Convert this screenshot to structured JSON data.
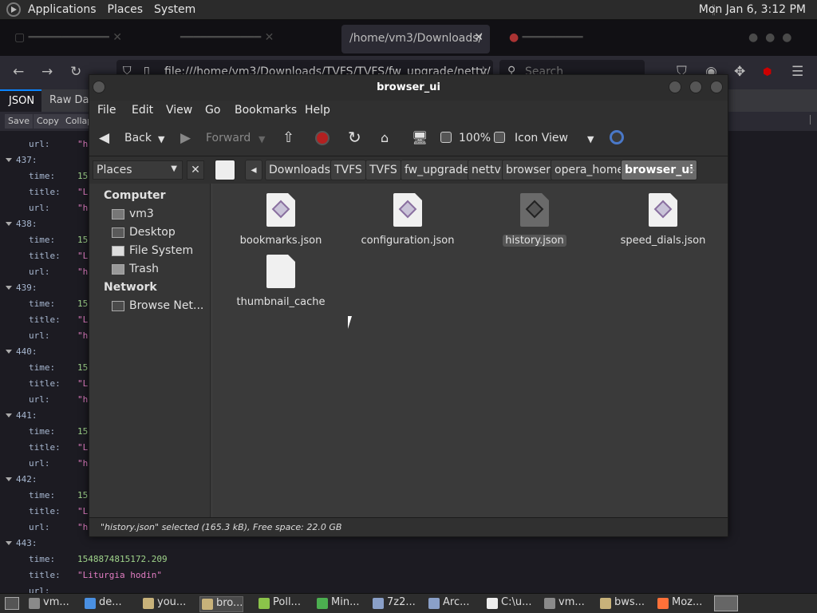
{
  "top_panel": {
    "menus": [
      "Applications",
      "Places",
      "System"
    ],
    "clock": "Mon Jan  6,  3:12 PM"
  },
  "browser": {
    "active_tab_title": "/home/vm3/Downloads/",
    "url": "file:///home/vm3/Downloads/TVFS/TVFS/fw_upgrade/nettv/",
    "search_placeholder": "Search",
    "json_tabs": [
      "JSON",
      "Raw Data"
    ],
    "json_tools": [
      "Save",
      "Copy",
      "Collap"
    ],
    "entries": [
      {
        "index": "437:",
        "time": "15",
        "title": "\"L",
        "url": "\"h"
      },
      {
        "index": "438:",
        "time": "15",
        "title": "\"L",
        "url": "\"h"
      },
      {
        "index": "439:",
        "time": "15",
        "title": "\"L",
        "url": "\"h"
      },
      {
        "index": "440:",
        "time": "15",
        "title": "\"L",
        "url": "\"h"
      },
      {
        "index": "441:",
        "time": "15",
        "title": "\"L",
        "url": "\"h"
      },
      {
        "index": "442:",
        "time": "15",
        "title": "\"L",
        "url": "\"h"
      },
      {
        "index": "443:",
        "time": "1548874815172.209",
        "title": "\"Liturgia hodin\"",
        "url": ""
      }
    ],
    "key_labels": {
      "time": "time:",
      "title": "title:",
      "url": "url:"
    },
    "first_url": "\"h"
  },
  "file_manager": {
    "title": "browser_ui",
    "menu": [
      "File",
      "Edit",
      "View",
      "Go",
      "Bookmarks",
      "Help"
    ],
    "toolbar": {
      "back": "Back",
      "forward": "Forward",
      "zoom": "100%",
      "view_mode": "Icon View"
    },
    "places_combo": "Places",
    "breadcrumbs": [
      "Downloads",
      "TVFS",
      "TVFS",
      "fw_upgrade",
      "nettv",
      "browser",
      "opera_home",
      "browser_ui"
    ],
    "sidebar": {
      "computer_header": "Computer",
      "computer_items": [
        "vm3",
        "Desktop",
        "File System",
        "Trash"
      ],
      "network_header": "Network",
      "network_items": [
        "Browse Net..."
      ]
    },
    "files": [
      {
        "name": "bookmarks.json",
        "selected": false
      },
      {
        "name": "configuration.json",
        "selected": false
      },
      {
        "name": "history.json",
        "selected": true
      },
      {
        "name": "speed_dials.json",
        "selected": false
      },
      {
        "name": "thumbnail_cache",
        "selected": false
      }
    ],
    "status": "\"history.json\" selected (165.3 kB), Free space: 22.0 GB"
  },
  "taskbar": {
    "items": [
      "vm...",
      "de...",
      "you...",
      "bro...",
      "Poll...",
      "Min...",
      "7z2...",
      "Arc...",
      "C:\\u...",
      "vm...",
      "bws...",
      "Moz..."
    ],
    "colors": [
      "#8a8a8a",
      "#4a90e2",
      "#c8b27a",
      "#c8b27a",
      "#8bc34a",
      "#4caf50",
      "#8aa0c8",
      "#8aa0c8",
      "#eeeeee",
      "#8a8a8a",
      "#c8b27a",
      "#ff7139"
    ]
  }
}
